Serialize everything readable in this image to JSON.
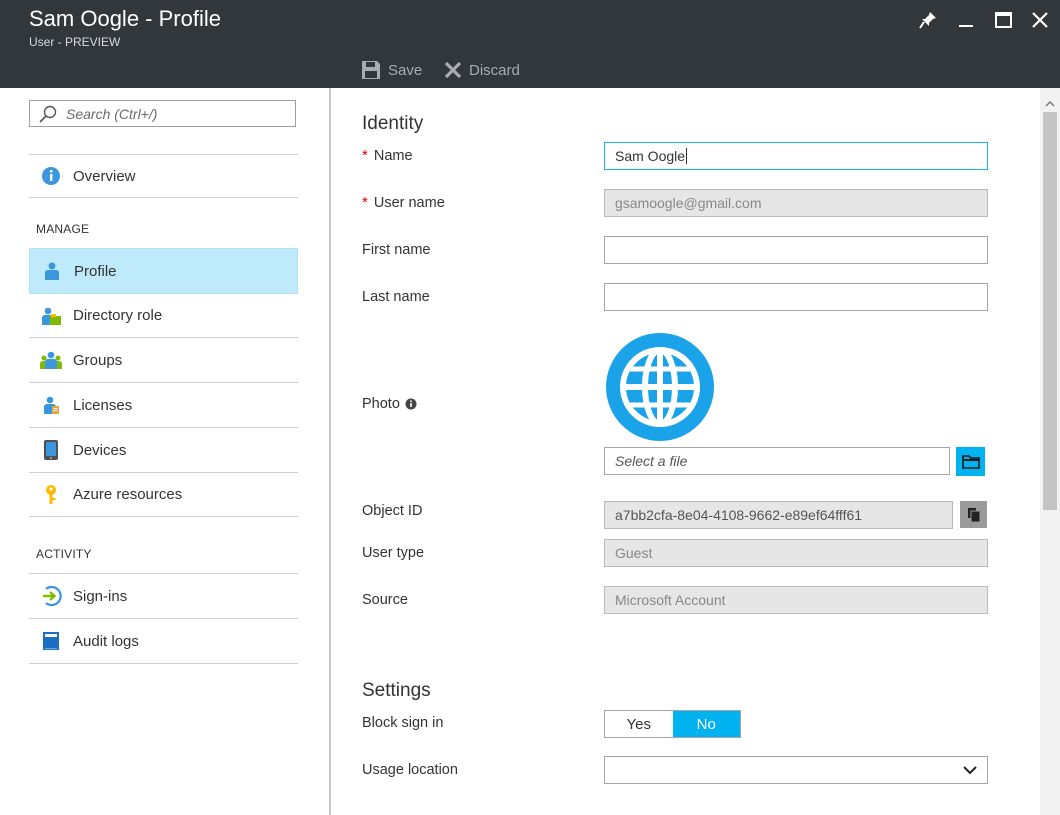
{
  "window": {
    "title": "Sam Oogle - Profile",
    "subtitle": "User - PREVIEW"
  },
  "toolbar": {
    "save_label": "Save",
    "discard_label": "Discard"
  },
  "sidebar": {
    "search_placeholder": "Search (Ctrl+/)",
    "overview": "Overview",
    "manage_header": "MANAGE",
    "manage_items": [
      {
        "label": "Profile",
        "icon": "user-icon",
        "active": true
      },
      {
        "label": "Directory role",
        "icon": "directory-role-icon"
      },
      {
        "label": "Groups",
        "icon": "groups-icon"
      },
      {
        "label": "Licenses",
        "icon": "licenses-icon"
      },
      {
        "label": "Devices",
        "icon": "device-icon"
      },
      {
        "label": "Azure resources",
        "icon": "key-icon"
      }
    ],
    "activity_header": "ACTIVITY",
    "activity_items": [
      {
        "label": "Sign-ins",
        "icon": "sign-in-icon"
      },
      {
        "label": "Audit logs",
        "icon": "audit-log-icon"
      }
    ]
  },
  "identity": {
    "title": "Identity",
    "name_label": "Name",
    "name_value": "Sam Oogle",
    "username_label": "User name",
    "username_value": "gsamoogle@gmail.com",
    "firstname_label": "First name",
    "firstname_value": "",
    "lastname_label": "Last name",
    "lastname_value": "",
    "photo_label": "Photo",
    "photo_placeholder": "Select a file",
    "objectid_label": "Object ID",
    "objectid_value": "a7bb2cfa-8e04-4108-9662-e89ef64fff61",
    "usertype_label": "User type",
    "usertype_value": "Guest",
    "source_label": "Source",
    "source_value": "Microsoft Account"
  },
  "settings": {
    "title": "Settings",
    "block_label": "Block sign in",
    "yes_label": "Yes",
    "no_label": "No",
    "block_selected": "No",
    "usage_label": "Usage location",
    "usage_value": ""
  },
  "colors": {
    "header_bg": "#32373b",
    "accent": "#00b3f0",
    "active_nav": "#bfeafb",
    "required": "#d70000"
  }
}
